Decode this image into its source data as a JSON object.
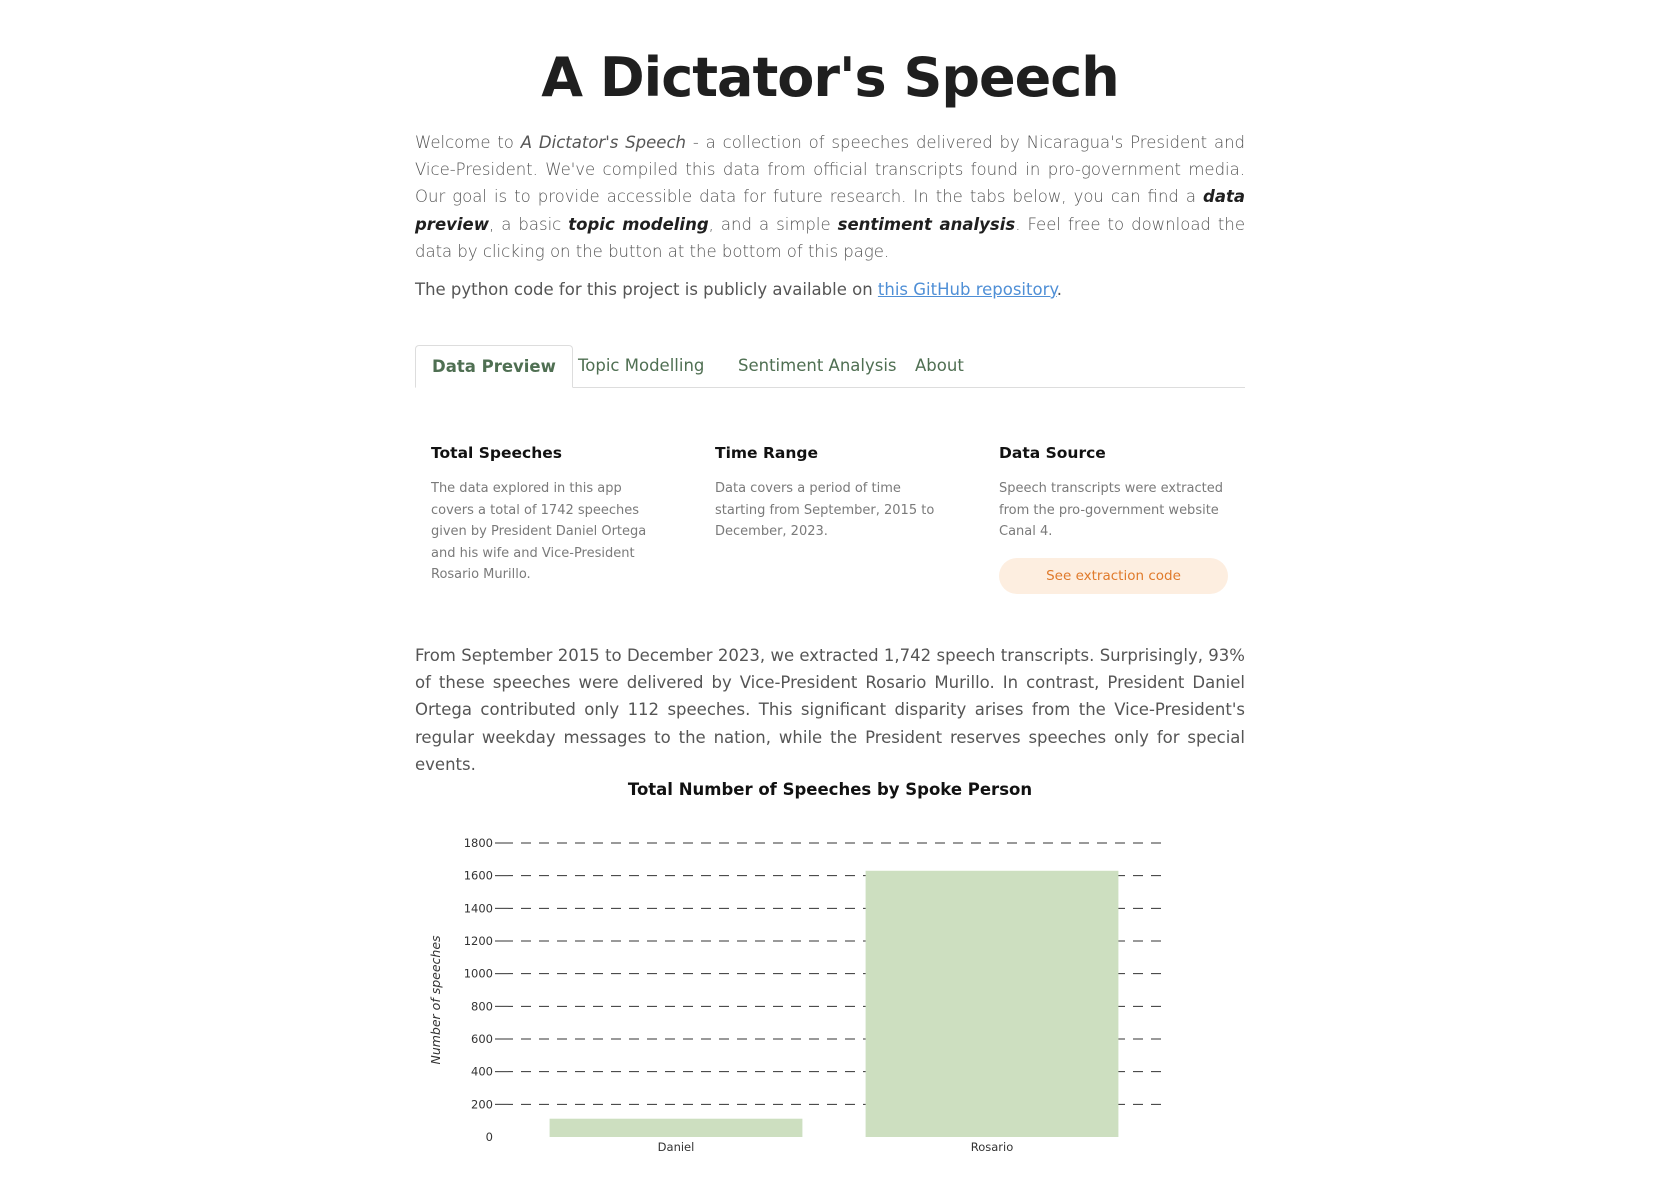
{
  "page": {
    "title": "A Dictator's Speech",
    "intro": {
      "p1": "Welcome to ",
      "em_title": "A Dictator's Speech",
      "p2": " - a collection of speeches delivered by Nicaragua's President and Vice-President. We've compiled this data from official transcripts found in pro-government media. Our goal is to provide accessible data for future research. In the tabs below, you can find a ",
      "bold1": "data preview",
      "p3": ", a basic ",
      "bold2": "topic modeling",
      "p4": ", and a simple ",
      "bold3": "sentiment analysis",
      "p5": ". Feel free to download the data by clicking on the button at the bottom of this page."
    },
    "repo": {
      "prefix": "The python code for this project is publicly available on ",
      "link_text": "this GitHub repository",
      "suffix": "."
    }
  },
  "tabs": [
    {
      "label": "Data Preview",
      "active": true
    },
    {
      "label": "Topic Modelling",
      "active": false
    },
    {
      "label": "Sentiment Analysis",
      "active": false
    },
    {
      "label": "About",
      "active": false
    }
  ],
  "cards": [
    {
      "title": "Total Speeches",
      "text": "The data explored in this app covers a total of 1742 speeches given by President Daniel Ortega and his wife and Vice-President Rosario Murillo."
    },
    {
      "title": "Time Range",
      "text": "Data covers a period of time starting from September, 2015 to December, 2023."
    },
    {
      "title": "Data Source",
      "text": "Speech transcripts were extracted from the pro-government website Canal 4.",
      "button_label": "See extraction code"
    }
  ],
  "summary": "From September 2015 to December 2023, we extracted 1,742 speech transcripts. Surprisingly, 93% of these speeches were delivered by Vice-President Rosario Murillo. In contrast, President Daniel Ortega contributed only 112 speeches. This significant disparity arises from the Vice-President's regular weekday messages to the nation, while the President reserves speeches only for special events.",
  "chart_data": {
    "type": "bar",
    "title": "Total Number of Speeches by Spoke Person",
    "xlabel": "",
    "ylabel": "Number of speeches",
    "categories": [
      "Daniel",
      "Rosario"
    ],
    "values": [
      112,
      1630
    ],
    "ylim": [
      0,
      1800
    ],
    "yticks": [
      0,
      200,
      400,
      600,
      800,
      1000,
      1200,
      1400,
      1600,
      1800
    ],
    "grid": "dashed-horizontal",
    "bar_color": "#cddfc0"
  }
}
